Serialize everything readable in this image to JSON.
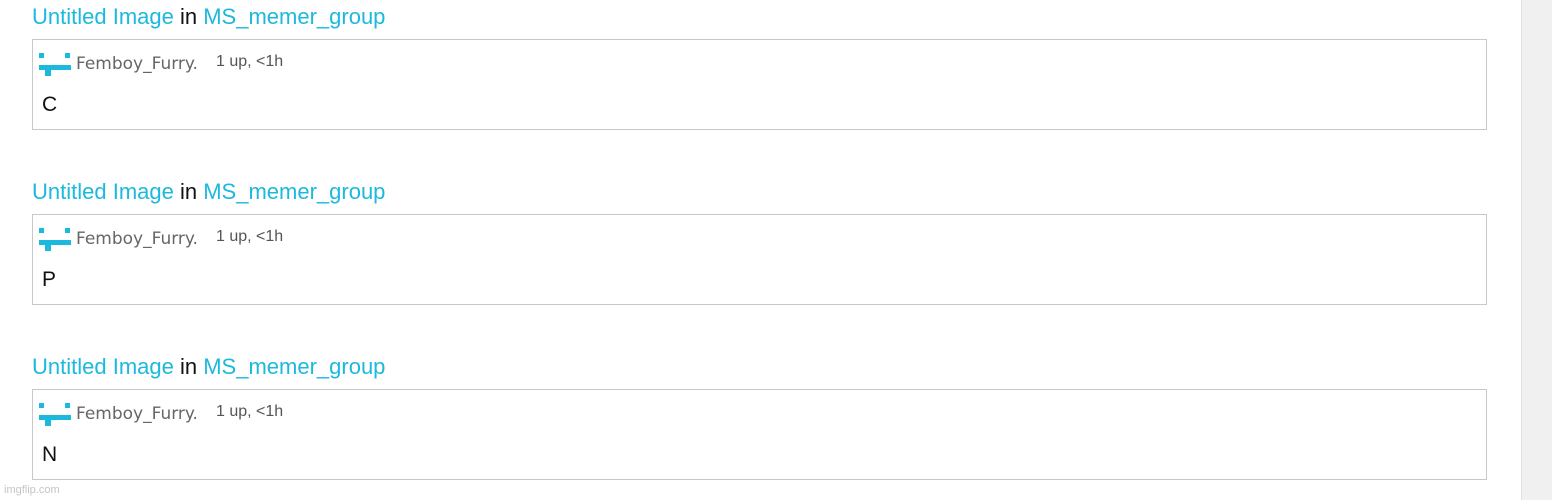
{
  "posts": [
    {
      "title": "Untitled Image",
      "in_word": "in",
      "group": "MS_memer_group",
      "username": "Femboy_Furry.",
      "stats": "1 up, <1h",
      "text": "C"
    },
    {
      "title": "Untitled Image",
      "in_word": "in",
      "group": "MS_memer_group",
      "username": "Femboy_Furry.",
      "stats": "1 up, <1h",
      "text": "P"
    },
    {
      "title": "Untitled Image",
      "in_word": "in",
      "group": "MS_memer_group",
      "username": "Femboy_Furry.",
      "stats": "1 up, <1h",
      "text": "N"
    }
  ],
  "avatar_icon": "pixel-face-icon",
  "colors": {
    "link": "#1cb9de",
    "avatar": "#1cb9de",
    "card_border": "#c8c8c8",
    "scrollbar": "#f0f0f0"
  },
  "watermark": "imgflip.com"
}
